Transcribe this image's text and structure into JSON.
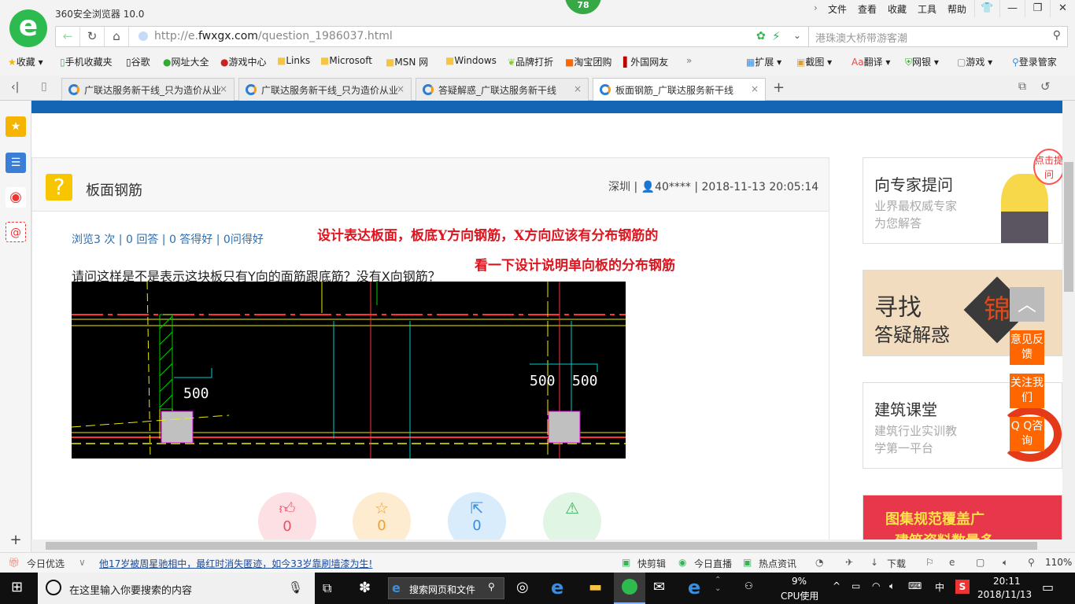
{
  "browser": {
    "title": "360安全浏览器 10.0",
    "badge": "78",
    "menu": [
      "文件",
      "查看",
      "收藏",
      "工具",
      "帮助"
    ],
    "url_prefix": "http://e.",
    "url_domain": "fwxgx.com",
    "url_path": "/question_1986037.html",
    "search_placeholder": "港珠澳大桥带游客潮"
  },
  "bookmarks": [
    "收藏",
    "手机收藏夹",
    "谷歌",
    "网址大全",
    "游戏中心",
    "Links",
    "Microsoft",
    "MSN 网",
    "Windows",
    "品牌打折",
    "淘宝团购",
    "外国网友"
  ],
  "tools": [
    "扩展",
    "截图",
    "翻译",
    "网银",
    "游戏",
    "登录管家"
  ],
  "tabs": [
    {
      "label": "广联达服务新干线_只为造价从业"
    },
    {
      "label": "广联达服务新干线_只为造价从业"
    },
    {
      "label": "答疑解惑_广联达服务新干线"
    },
    {
      "label": "板面钢筋_广联达服务新干线",
      "active": true
    }
  ],
  "question": {
    "title": "板面钢筋",
    "location": "深圳",
    "user": "40****",
    "datetime": "2018-11-13 20:05:14",
    "stats": "浏览3 次 | 0 回答 | 0 答得好 | 0问得好",
    "text": "请问这样是不是表示这块板只有Y向的面筋跟底筋？没有X向钢筋？",
    "annotation1": "设计表达板面，板底Y方向钢筋，X方向应该有分布钢筋的",
    "annotation2": "看一下设计说明单向板的分布钢筋",
    "cad_labels": [
      "500",
      "500",
      "500"
    ],
    "actions": [
      {
        "icon": "thumbs-up",
        "count": "0",
        "color": "#fde0e4",
        "fg": "#e8506a"
      },
      {
        "icon": "star",
        "count": "0",
        "color": "#fdeccf",
        "fg": "#f0a030"
      },
      {
        "icon": "share",
        "count": "0",
        "color": "#d8ecfb",
        "fg": "#3a8ee0"
      },
      {
        "icon": "warning",
        "count": "",
        "color": "#e0f5e4",
        "fg": "#3cb35a"
      }
    ]
  },
  "sidebar": {
    "expert_title": "向专家提问",
    "expert_desc1": "业界最权威专家",
    "expert_desc2": "为您解答",
    "bubble": "点击提问",
    "banner_title": "寻找",
    "banner_sub": "答疑解惑",
    "banner_char": "锦",
    "course_title": "建筑课堂",
    "course_desc1": "建筑行业实训教",
    "course_desc2": "学第一平台",
    "ad_text": "图集规范覆盖广",
    "ad_text2": "建筑资料数量多"
  },
  "float": {
    "feedback": "意见反馈",
    "follow": "关注我们",
    "qq": "Q Q咨询"
  },
  "status": {
    "today": "今日优选",
    "news": "他17岁被周星驰相中，最红时消失匿迹，如今33岁靠刷墙漆为生!",
    "items": [
      "快剪辑",
      "今日直播",
      "热点资讯",
      "下载"
    ],
    "zoom": "110%"
  },
  "taskbar": {
    "search": "在这里输入你要搜索的内容",
    "web_search": "搜索网页和文件",
    "cpu": "9%",
    "cpu_label": "CPU使用",
    "ime": "中",
    "time": "20:11",
    "date": "2018/11/13"
  }
}
